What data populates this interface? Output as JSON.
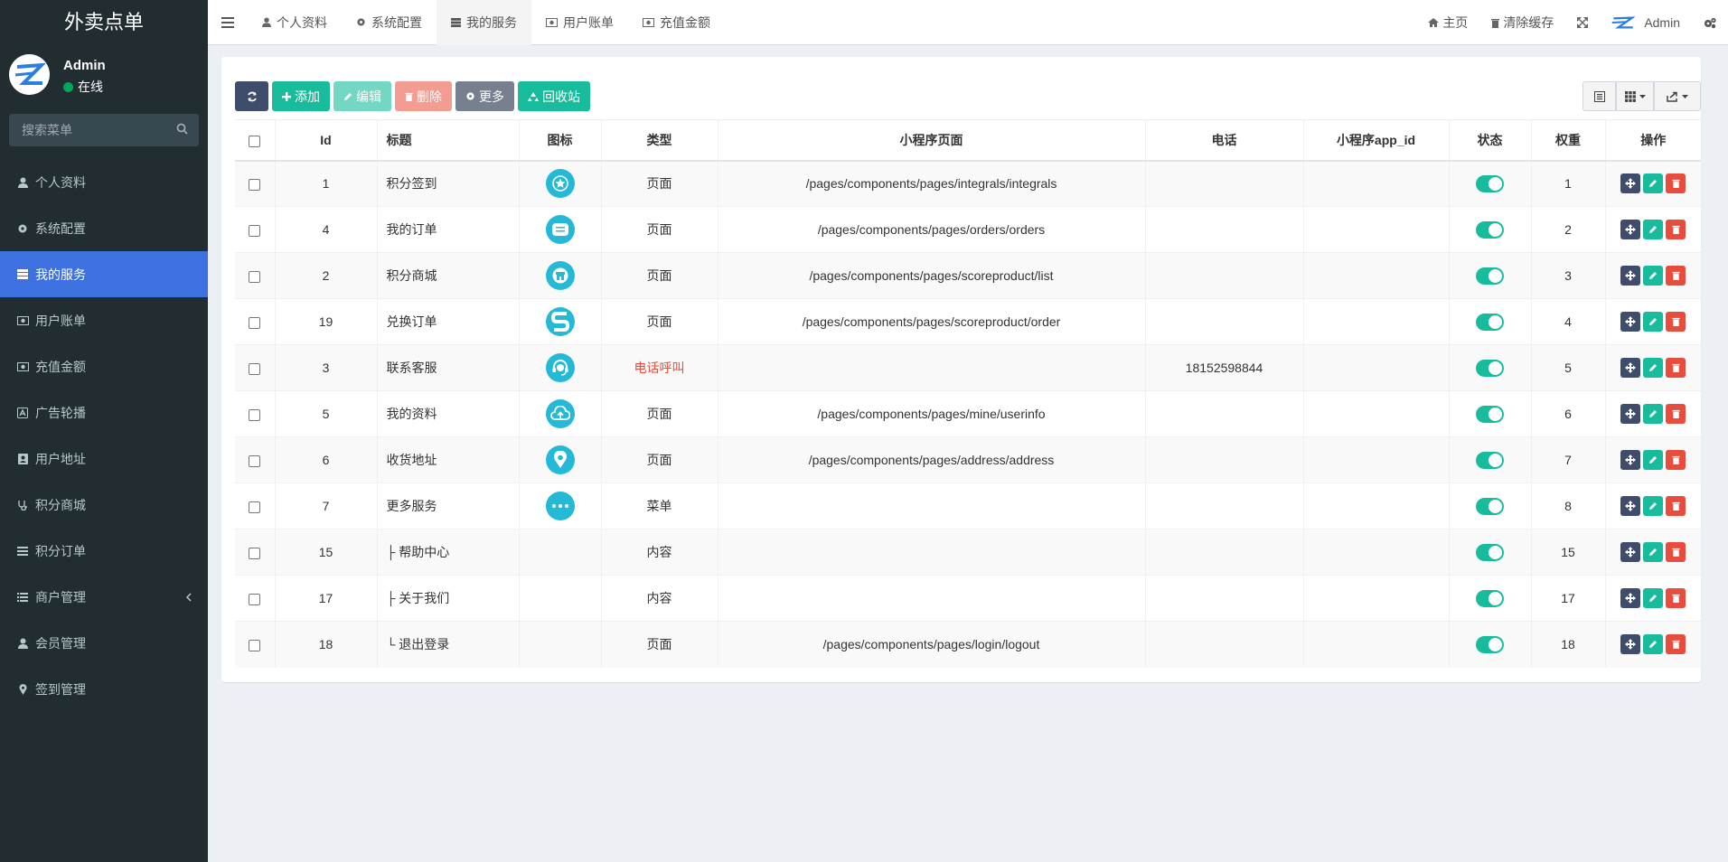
{
  "brand": "外卖点单",
  "user": {
    "name": "Admin",
    "status": "在线"
  },
  "search": {
    "placeholder": "搜索菜单"
  },
  "sidebar": {
    "items": [
      {
        "label": "个人资料",
        "icon": "user-icon"
      },
      {
        "label": "系统配置",
        "icon": "gear-icon"
      },
      {
        "label": "我的服务",
        "icon": "server-icon",
        "active": true
      },
      {
        "label": "用户账单",
        "icon": "money-icon"
      },
      {
        "label": "充值金额",
        "icon": "money-icon"
      },
      {
        "label": "广告轮播",
        "icon": "font-icon"
      },
      {
        "label": "用户地址",
        "icon": "address-book-icon"
      },
      {
        "label": "积分商城",
        "icon": "stethoscope-icon"
      },
      {
        "label": "积分订单",
        "icon": "bars-icon"
      },
      {
        "label": "商户管理",
        "icon": "list-icon"
      },
      {
        "label": "会员管理",
        "icon": "user-icon"
      },
      {
        "label": "签到管理",
        "icon": "map-marker-icon"
      }
    ]
  },
  "tabs": [
    {
      "label": "个人资料"
    },
    {
      "label": "系统配置"
    },
    {
      "label": "我的服务",
      "active": true
    },
    {
      "label": "用户账单"
    },
    {
      "label": "充值金额"
    }
  ],
  "topright": {
    "home": "主页",
    "clear_cache": "清除缓存",
    "admin": "Admin"
  },
  "toolbar": {
    "add": "添加",
    "edit": "编辑",
    "delete": "删除",
    "more": "更多",
    "recycle": "回收站"
  },
  "table": {
    "headers": [
      "Id",
      "标题",
      "图标",
      "类型",
      "小程序页面",
      "电话",
      "小程序app_id",
      "状态",
      "权重",
      "操作"
    ],
    "rows": [
      {
        "id": "1",
        "title": "积分签到",
        "icon": "star-icon",
        "type": "页面",
        "page": "/pages/components/pages/integrals/integrals",
        "phone": "",
        "appid": "",
        "weight": "1"
      },
      {
        "id": "4",
        "title": "我的订单",
        "icon": "order-icon",
        "type": "页面",
        "page": "/pages/components/pages/orders/orders",
        "phone": "",
        "appid": "",
        "weight": "2"
      },
      {
        "id": "2",
        "title": "积分商城",
        "icon": "shop-icon",
        "type": "页面",
        "page": "/pages/components/pages/scoreproduct/list",
        "phone": "",
        "appid": "",
        "weight": "3"
      },
      {
        "id": "19",
        "title": "兑换订单",
        "icon": "exchange-icon",
        "type": "页面",
        "page": "/pages/components/pages/scoreproduct/order",
        "phone": "",
        "appid": "",
        "weight": "4"
      },
      {
        "id": "3",
        "title": "联系客服",
        "icon": "headset-icon",
        "type": "电话呼叫",
        "type_color": "#e74c3c",
        "page": "",
        "phone": "18152598844",
        "appid": "",
        "weight": "5"
      },
      {
        "id": "5",
        "title": "我的资料",
        "icon": "upload-cloud-icon",
        "type": "页面",
        "page": "/pages/components/pages/mine/userinfo",
        "phone": "",
        "appid": "",
        "weight": "6"
      },
      {
        "id": "6",
        "title": "收货地址",
        "icon": "location-icon",
        "type": "页面",
        "page": "/pages/components/pages/address/address",
        "phone": "",
        "appid": "",
        "weight": "7"
      },
      {
        "id": "7",
        "title": "更多服务",
        "icon": "more-dots-icon",
        "type": "菜单",
        "page": "",
        "phone": "",
        "appid": "",
        "weight": "8"
      },
      {
        "id": "15",
        "title": "├ 帮助中心",
        "icon": "",
        "type": "内容",
        "page": "",
        "phone": "",
        "appid": "",
        "weight": "15"
      },
      {
        "id": "17",
        "title": "├ 关于我们",
        "icon": "",
        "type": "内容",
        "page": "",
        "phone": "",
        "appid": "",
        "weight": "17"
      },
      {
        "id": "18",
        "title": "└ 退出登录",
        "icon": "",
        "type": "页面",
        "page": "/pages/components/pages/login/logout",
        "phone": "",
        "appid": "",
        "weight": "18"
      }
    ]
  }
}
